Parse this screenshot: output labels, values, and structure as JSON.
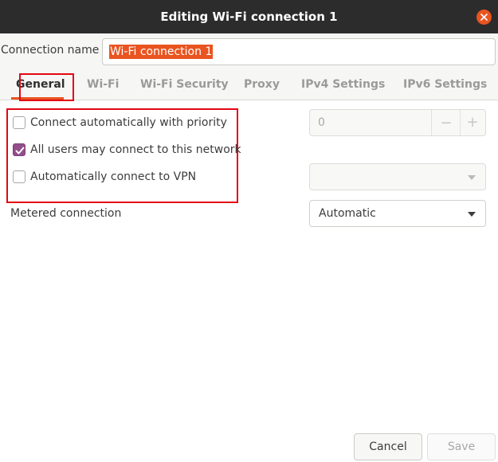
{
  "window": {
    "title": "Editing Wi-Fi connection 1"
  },
  "connection": {
    "label": "Connection name",
    "value": "Wi-Fi connection 1"
  },
  "tabs": [
    {
      "label": "General",
      "active": true
    },
    {
      "label": "Wi-Fi",
      "active": false
    },
    {
      "label": "Wi-Fi Security",
      "active": false
    },
    {
      "label": "Proxy",
      "active": false
    },
    {
      "label": "IPv4 Settings",
      "active": false
    },
    {
      "label": "IPv6 Settings",
      "active": false
    }
  ],
  "general": {
    "connect_auto": {
      "label": "Connect automatically with priority",
      "checked": false
    },
    "priority_value": "0",
    "priority_minus": "−",
    "priority_plus": "+",
    "all_users": {
      "label": "All users may connect to this network",
      "checked": true
    },
    "auto_vpn": {
      "label": "Automatically connect to VPN",
      "checked": false
    },
    "vpn_selected": "",
    "metered_label": "Metered connection",
    "metered_value": "Automatic"
  },
  "buttons": {
    "cancel": "Cancel",
    "save": "Save"
  },
  "colors": {
    "accent": "#e95420",
    "check": "#924d8b",
    "highlight": "#e30613",
    "titlebar": "#2c2c2c"
  }
}
